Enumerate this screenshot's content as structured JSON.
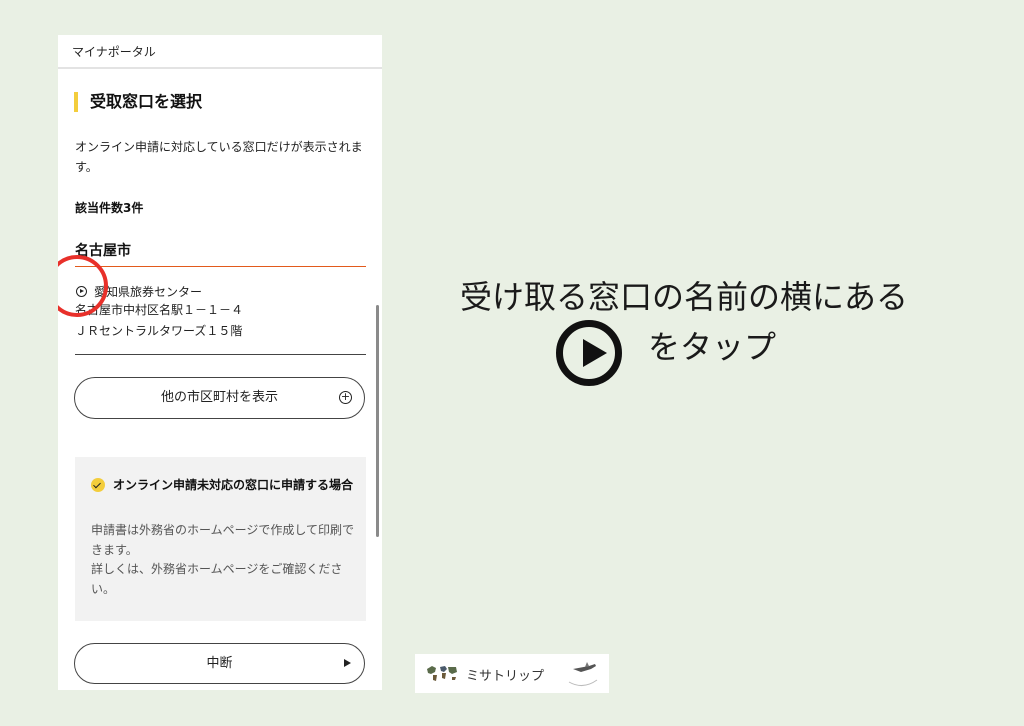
{
  "app": {
    "title": "マイナポータル"
  },
  "section": {
    "heading": "受取窓口を選択",
    "description": "オンライン申請に対応している窓口だけが表示されます。",
    "result_count": "該当件数3件"
  },
  "results": {
    "city": "名古屋市",
    "office": {
      "name": "愛知県旅券センター",
      "address_line1": "名古屋市中村区名駅１－１－４",
      "address_line2": "ＪＲセントラルタワーズ１５階"
    }
  },
  "buttons": {
    "other_municipalities": "他の市区町村を表示",
    "cancel": "中断"
  },
  "note": {
    "title": "オンライン申請未対応の窓口に申請する場合",
    "body_line1": "申請書は外務省のホームページで作成して印刷できます。",
    "body_line2": "詳しくは、外務省ホームページをご確認ください。"
  },
  "instruction": {
    "line1": "受け取る窓口の名前の横にある",
    "line2": "をタップ"
  },
  "watermark": {
    "text": "ミサトリップ"
  },
  "colors": {
    "background": "#e9f0e4",
    "heading_accent": "#f3cd3c",
    "city_underline": "#e25a1c",
    "highlight_circle": "#e8302a"
  },
  "icons": {
    "office_select": "play-circle-icon",
    "other_municipalities": "plus-circle-icon",
    "note": "check-circle-icon",
    "cancel": "play-arrow-icon",
    "instruction": "play-circle-icon"
  }
}
